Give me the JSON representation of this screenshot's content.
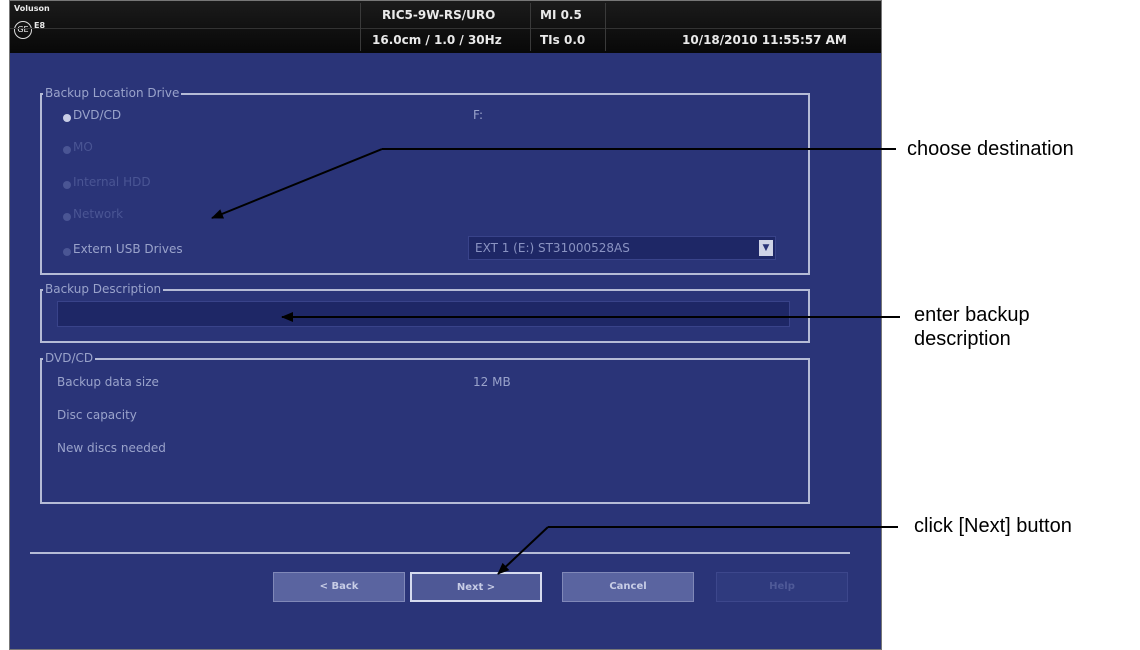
{
  "topbar": {
    "brand": "Voluson",
    "model": "E8",
    "logo": "GE",
    "probe": "RIC5-9W-RS/URO",
    "mi": "MI  0.5",
    "settings": "16.0cm / 1.0 / 30Hz",
    "tis": "TIs  0.0",
    "datetime": "10/18/2010  11:55:57 AM"
  },
  "backup_location": {
    "title": "Backup Location Drive",
    "options": [
      "DVD/CD",
      "MO",
      "Internal HDD",
      "Network",
      "Extern USB Drives"
    ],
    "selected": "DVD/CD",
    "dvd_drive_letter": "F:",
    "usb_drive_value": "EXT 1 (E:) ST31000528AS"
  },
  "backup_description": {
    "title": "Backup Description",
    "value": ""
  },
  "dvd": {
    "title": "DVD/CD",
    "rows": [
      {
        "label": "Backup data size",
        "value": "12 MB"
      },
      {
        "label": "Disc capacity",
        "value": ""
      },
      {
        "label": "New discs needed",
        "value": ""
      }
    ]
  },
  "buttons": {
    "back": "< Back",
    "next": "Next >",
    "cancel": "Cancel",
    "help": "Help"
  },
  "callouts": {
    "choose_destination": "choose destination",
    "enter_backup_line1": "enter backup",
    "enter_backup_line2": "description",
    "click_next": "click [Next] button"
  }
}
